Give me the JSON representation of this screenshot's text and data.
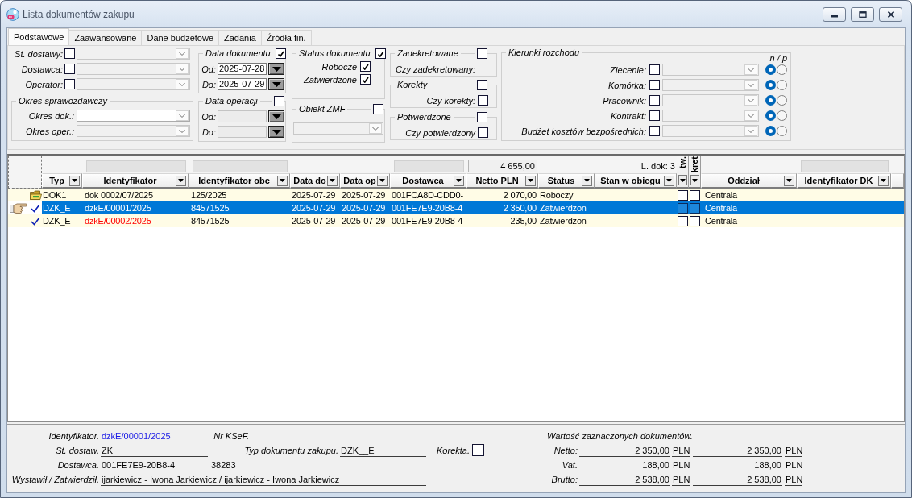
{
  "window": {
    "title": "Lista dokumentów zakupu"
  },
  "tabs": [
    {
      "label": "Podstawowe",
      "selected": true
    },
    {
      "label": "Zaawansowane",
      "selected": false
    },
    {
      "label": "Dane budżetowe",
      "selected": false
    },
    {
      "label": "Zadania",
      "selected": false
    },
    {
      "label": "Źródła fin.",
      "selected": false
    }
  ],
  "filters": {
    "lookups": [
      {
        "label": "St. dostawy:",
        "checked": false,
        "disabled": true
      },
      {
        "label": "Dostawca:",
        "checked": false,
        "disabled": true
      },
      {
        "label": "Operator:",
        "checked": false,
        "disabled": true
      }
    ],
    "reporting_period": {
      "title": "Okres sprawozdawczy",
      "rows": [
        {
          "label": "Okres dok.:",
          "disabled": false
        },
        {
          "label": "Okres oper.:",
          "disabled": true
        }
      ]
    },
    "document_date": {
      "title": "Data dokumentu",
      "checked": true,
      "fields": [
        {
          "label": "Od:",
          "value": "2025-07-28",
          "disabled": false
        },
        {
          "label": "Do:",
          "value": "2025-07-29",
          "disabled": false
        }
      ]
    },
    "operation_date": {
      "title": "Data operacji",
      "checked": false,
      "fields": [
        {
          "label": "Od:",
          "disabled": true
        },
        {
          "label": "Do:",
          "disabled": true
        }
      ]
    },
    "document_status": {
      "title": "Status dokumentu",
      "checked": true,
      "options": [
        {
          "label": "Robocze",
          "checked": true
        },
        {
          "label": "Zatwierdzone",
          "checked": true
        }
      ]
    },
    "zmf_object": {
      "title": "Obiekt ZMF",
      "checked": false,
      "disabled": true
    },
    "flag_groups": [
      {
        "title": "Zadekretowane",
        "checked": false,
        "question": "Czy zadekretowany:"
      },
      {
        "title": "Korekty",
        "checked": false,
        "question": "Czy korekty:",
        "question_checked": false
      },
      {
        "title": "Potwierdzone",
        "checked": false,
        "question": "Czy potwierdzony",
        "question_checked": false
      }
    ],
    "cost_directions": {
      "title": "Kierunki rozchodu",
      "header": "n / p",
      "rows": [
        {
          "label": "Zlecenie:",
          "checked": false,
          "disabled": true,
          "options": [
            {
              "selected": true
            },
            {
              "selected": false
            }
          ]
        },
        {
          "label": "Komórka:",
          "checked": false,
          "disabled": true,
          "options": [
            {
              "selected": true
            },
            {
              "selected": false
            }
          ]
        },
        {
          "label": "Pracownik:",
          "checked": false,
          "disabled": true,
          "options": [
            {
              "selected": true
            },
            {
              "selected": false
            }
          ]
        },
        {
          "label": "Kontrakt:",
          "checked": false,
          "disabled": true,
          "options": [
            {
              "selected": true
            },
            {
              "selected": false
            }
          ]
        },
        {
          "label": "Budżet kosztów bezpośrednich:",
          "checked": false,
          "disabled": true,
          "options": [
            {
              "selected": true
            },
            {
              "selected": false
            }
          ]
        }
      ]
    }
  },
  "table": {
    "columns": [
      {
        "label": "Typ",
        "kind": "text",
        "filter": false
      },
      {
        "label": "Identyfikator",
        "kind": "text",
        "filter": true
      },
      {
        "label": "Identyfikator obc",
        "kind": "text",
        "filter": true
      },
      {
        "label": "Data do",
        "kind": "text",
        "filter": false
      },
      {
        "label": "Data op",
        "kind": "text",
        "filter": false
      },
      {
        "label": "Dostawca",
        "kind": "text",
        "filter": true
      },
      {
        "label": "Netto PLN",
        "kind": "number",
        "total": "4 655,00"
      },
      {
        "label": "Status",
        "kind": "text",
        "filter": false
      },
      {
        "label": "Stan w obiegu",
        "kind": "text",
        "filter": false,
        "count": "L. dok: 3"
      },
      {
        "label": "tw.",
        "kind": "check"
      },
      {
        "label": "kret",
        "kind": "check"
      },
      {
        "label": "Oddział",
        "kind": "text",
        "filter": false
      },
      {
        "label": "Identyfikator DK",
        "kind": "text",
        "filter": true
      }
    ],
    "rows": [
      {
        "selected": false,
        "kind": "folder",
        "warning": false,
        "typ": "DOK1",
        "identyfikator": "dok 0002/07/2025",
        "identyfikator_obcy": "125/2025",
        "data_dok": "2025-07-29",
        "data_op": "2025-07-29",
        "dostawca": "001FCA8D-CDD0-",
        "netto_pln": "2 070,00",
        "status": "Roboczy",
        "column_10": false,
        "column_11": false,
        "oddzial": "Centrala"
      },
      {
        "selected": true,
        "kind": "check",
        "warning": false,
        "typ": "DZK_E",
        "identyfikator": "dzkE/00001/2025",
        "identyfikator_obcy": "84571525",
        "data_dok": "2025-07-29",
        "data_op": "2025-07-29",
        "dostawca": "001FE7E9-20B8-4",
        "netto_pln": "2 350,00",
        "status": "Zatwierdzon",
        "column_10": false,
        "column_11": false,
        "oddzial": "Centrala"
      },
      {
        "selected": false,
        "kind": "check",
        "warning": true,
        "typ": "DZK_E",
        "identyfikator": "dzkE/00002/2025",
        "identyfikator_obcy": "84571525",
        "data_dok": "2025-07-29",
        "data_op": "2025-07-29",
        "dostawca": "001FE7E9-20B8-4",
        "netto_pln": "235,00",
        "status": "Zatwierdzon",
        "column_10": false,
        "column_11": false,
        "oddzial": "Centrala"
      }
    ]
  },
  "details": {
    "identifier": {
      "label": "Identyfikator.",
      "value": "dzkE/00001/2025"
    },
    "ksef": {
      "label": "Nr KSeF."
    },
    "delivery_status": {
      "label": "St. dostaw.",
      "value": "ZK"
    },
    "document_type": {
      "label": "Typ dokumentu zakupu.",
      "value": "DZK__E"
    },
    "correction": {
      "label": "Korekta.",
      "checked": false
    },
    "supplier": {
      "label": "Dostawca.",
      "value": "001FE7E9-20B8-4",
      "code": "38283"
    },
    "issued_approved": {
      "label": "Wystawił / Zatwierdził.",
      "value": "ijarkiewicz - Iwona Jarkiewicz / ijarkiewicz - Iwona Jarkiewicz"
    },
    "summary": {
      "title": "Wartość zaznaczonych dokumentów.",
      "rows": [
        {
          "label": "Netto:",
          "value_1": "2 350,00",
          "currency_1": "PLN",
          "value_2": "2 350,00",
          "currency_2": "PLN"
        },
        {
          "label": "Vat.",
          "value_1": "188,00",
          "currency_1": "PLN",
          "value_2": "188,00",
          "currency_2": "PLN"
        },
        {
          "label": "Brutto:",
          "value_1": "2 538,00",
          "currency_1": "PLN",
          "value_2": "2 538,00",
          "currency_2": "PLN"
        }
      ]
    }
  }
}
